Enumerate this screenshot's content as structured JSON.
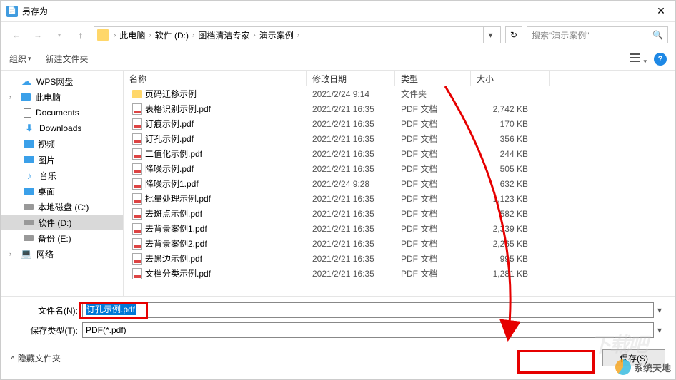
{
  "window": {
    "title": "另存为"
  },
  "breadcrumb": {
    "items": [
      "此电脑",
      "软件 (D:)",
      "图档清洁专家",
      "演示案例"
    ]
  },
  "search": {
    "placeholder": "搜索\"演示案例\""
  },
  "toolbar": {
    "organize": "组织",
    "newfolder": "新建文件夹"
  },
  "sidebar": {
    "items": [
      {
        "label": "WPS网盘",
        "icon": "cloud",
        "indent": 0
      },
      {
        "label": "此电脑",
        "icon": "pc",
        "indent": 0,
        "expandable": true
      },
      {
        "label": "Documents",
        "icon": "doc",
        "indent": 1
      },
      {
        "label": "Downloads",
        "icon": "dl",
        "indent": 1
      },
      {
        "label": "视频",
        "icon": "vid",
        "indent": 1
      },
      {
        "label": "图片",
        "icon": "img",
        "indent": 1
      },
      {
        "label": "音乐",
        "icon": "mus",
        "indent": 1
      },
      {
        "label": "桌面",
        "icon": "desk",
        "indent": 1
      },
      {
        "label": "本地磁盘 (C:)",
        "icon": "drive",
        "indent": 1
      },
      {
        "label": "软件 (D:)",
        "icon": "drive",
        "indent": 1,
        "selected": true
      },
      {
        "label": "备份 (E:)",
        "icon": "drive",
        "indent": 1
      },
      {
        "label": "网络",
        "icon": "net",
        "indent": 0,
        "expandable": true
      }
    ]
  },
  "columns": {
    "name": "名称",
    "date": "修改日期",
    "type": "类型",
    "size": "大小"
  },
  "files": [
    {
      "name": "页码迁移示例",
      "date": "2021/2/24 9:14",
      "type": "文件夹",
      "size": "",
      "icon": "folder"
    },
    {
      "name": "表格识别示例.pdf",
      "date": "2021/2/21 16:35",
      "type": "PDF 文档",
      "size": "2,742 KB",
      "icon": "pdf"
    },
    {
      "name": "订痕示例.pdf",
      "date": "2021/2/21 16:35",
      "type": "PDF 文档",
      "size": "170 KB",
      "icon": "pdf"
    },
    {
      "name": "订孔示例.pdf",
      "date": "2021/2/21 16:35",
      "type": "PDF 文档",
      "size": "356 KB",
      "icon": "pdf"
    },
    {
      "name": "二值化示例.pdf",
      "date": "2021/2/21 16:35",
      "type": "PDF 文档",
      "size": "244 KB",
      "icon": "pdf"
    },
    {
      "name": "降噪示例.pdf",
      "date": "2021/2/21 16:35",
      "type": "PDF 文档",
      "size": "505 KB",
      "icon": "pdf"
    },
    {
      "name": "降噪示例1.pdf",
      "date": "2021/2/24 9:28",
      "type": "PDF 文档",
      "size": "632 KB",
      "icon": "pdf"
    },
    {
      "name": "批量处理示例.pdf",
      "date": "2021/2/21 16:35",
      "type": "PDF 文档",
      "size": "1,123 KB",
      "icon": "pdf"
    },
    {
      "name": "去斑点示例.pdf",
      "date": "2021/2/21 16:35",
      "type": "PDF 文档",
      "size": "582 KB",
      "icon": "pdf"
    },
    {
      "name": "去背景案例1.pdf",
      "date": "2021/2/21 16:35",
      "type": "PDF 文档",
      "size": "2,339 KB",
      "icon": "pdf"
    },
    {
      "name": "去背景案例2.pdf",
      "date": "2021/2/21 16:35",
      "type": "PDF 文档",
      "size": "2,265 KB",
      "icon": "pdf"
    },
    {
      "name": "去黑边示例.pdf",
      "date": "2021/2/21 16:35",
      "type": "PDF 文档",
      "size": "995 KB",
      "icon": "pdf"
    },
    {
      "name": "文档分类示例.pdf",
      "date": "2021/2/21 16:35",
      "type": "PDF 文档",
      "size": "1,281 KB",
      "icon": "pdf"
    }
  ],
  "form": {
    "filename_label": "文件名(N):",
    "filename_value": "订孔示例.pdf",
    "filetype_label": "保存类型(T):",
    "filetype_value": "PDF(*.pdf)"
  },
  "footer": {
    "hide_folders": "隐藏文件夹",
    "save": "保存(S)"
  },
  "watermark": {
    "text": "系统天地"
  }
}
